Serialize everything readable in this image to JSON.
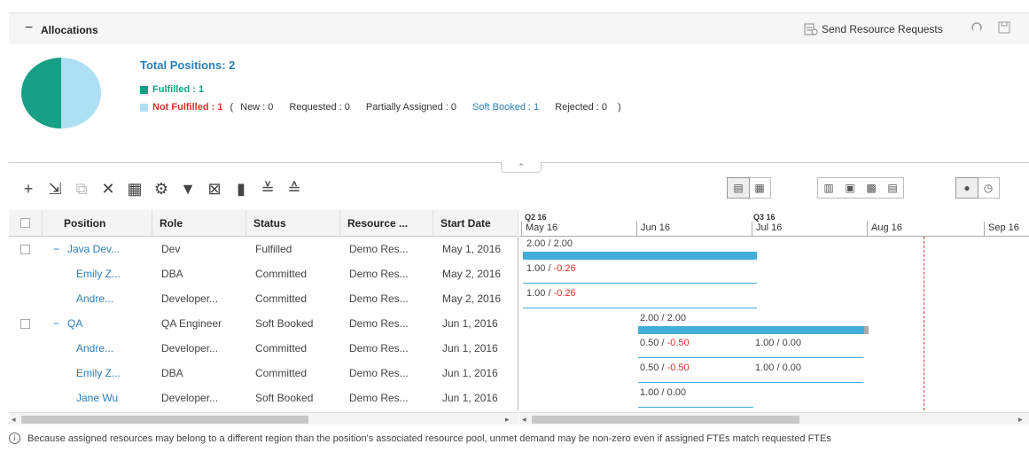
{
  "header": {
    "title": "Allocations",
    "collapse_glyph": "−",
    "send_requests": "Send Resource Requests",
    "send_icon": "send-request-icon",
    "refresh_icon": "refresh-icon",
    "save_icon": "save-icon"
  },
  "summary": {
    "total_label": "Total Positions:",
    "total_value": "2",
    "fulfilled_label": "Fulfilled : 1",
    "not_fulfilled_label": "Not Fulfilled : 1",
    "paren_open": "(",
    "paren_close": ")",
    "new": "New : 0",
    "requested": "Requested : 0",
    "partially": "Partially Assigned : 0",
    "soft_booked": "Soft Booked : 1",
    "rejected": "Rejected : 0",
    "colors": {
      "fulfilled": "#17a085",
      "not_fulfilled": "#aee0f5"
    },
    "pie": {
      "fulfilled": 1,
      "not_fulfilled": 1
    }
  },
  "grip_glyph": "⌃",
  "toolbar": {
    "icons": [
      "add-icon",
      "import-icon",
      "copy-icon",
      "delete-icon",
      "assign-icon",
      "settings-icon",
      "filter-icon",
      "export-icon",
      "chart-icon",
      "expand-all-icon",
      "collapse-all-icon"
    ],
    "glyphs": [
      "+",
      "⇲",
      "⧉",
      "✕",
      "▦",
      "⚙",
      "▼",
      "⊠",
      "▮",
      "≚",
      "≙"
    ],
    "disabled": [
      false,
      false,
      true,
      false,
      false,
      false,
      false,
      false,
      false,
      false,
      false
    ],
    "view_groups": [
      {
        "names": [
          "table-view-icon",
          "grid-view-icon"
        ],
        "glyphs": [
          "▤",
          "▦"
        ]
      },
      {
        "names": [
          "calendar-year-icon",
          "calendar-quarter-icon",
          "calendar-month-icon",
          "calendar-week-icon"
        ],
        "glyphs": [
          "▥",
          "▣",
          "▩",
          "▤"
        ]
      },
      {
        "names": [
          "person-icon",
          "clock-icon"
        ],
        "glyphs": [
          "●",
          "◷"
        ]
      }
    ]
  },
  "table": {
    "columns": [
      "Position",
      "Role",
      "Status",
      "Resource ...",
      "Start Date"
    ],
    "rows": [
      {
        "type": "group",
        "position": "Java Dev...",
        "role": "Dev",
        "status": "Fulfilled",
        "resource": "Demo Res...",
        "start": "May 1, 2016"
      },
      {
        "type": "child",
        "position": "Emily Z...",
        "role": "DBA",
        "status": "Committed",
        "resource": "Demo Res...",
        "start": "May 2, 2016"
      },
      {
        "type": "child",
        "position": "Andre...",
        "role": "Developer...",
        "status": "Committed",
        "resource": "Demo Res...",
        "start": "May 2, 2016"
      },
      {
        "type": "group",
        "position": "QA",
        "role": "QA Engineer",
        "status": "Soft Booked",
        "resource": "Demo Res...",
        "start": "Jun 1, 2016"
      },
      {
        "type": "child",
        "position": "Andre...",
        "role": "Developer...",
        "status": "Committed",
        "resource": "Demo Res...",
        "start": "Jun 1, 2016"
      },
      {
        "type": "child",
        "position": "Emily Z...",
        "role": "DBA",
        "status": "Committed",
        "resource": "Demo Res...",
        "start": "Jun 1, 2016"
      },
      {
        "type": "child",
        "position": "Jane Wu",
        "role": "Developer...",
        "status": "Soft Booked",
        "resource": "Demo Res...",
        "start": "Jun 1, 2016"
      }
    ]
  },
  "gantt": {
    "quarters": [
      "Q2 16",
      "Q3 16"
    ],
    "months": [
      "May 16",
      "Jun 16",
      "Jul 16",
      "Aug 16",
      "Sep 16"
    ],
    "rows": [
      {
        "a": "2.00 / 2.00",
        "aneg": ""
      },
      {
        "a": "1.00 / ",
        "aneg": "-0.26"
      },
      {
        "a": "1.00 / ",
        "aneg": "-0.26"
      },
      {
        "a": "2.00 / 2.00",
        "aneg": ""
      },
      {
        "a": "0.50 / ",
        "aneg": "-0.50",
        "b": "1.00 / 0.00"
      },
      {
        "a": "0.50 / ",
        "aneg": "-0.50",
        "b": "1.00 / 0.00"
      },
      {
        "a": "1.00 / 0.00",
        "aneg": ""
      }
    ]
  },
  "footer": {
    "info_icon": "info-icon",
    "info_glyph": "i",
    "note": "Because assigned resources may belong to a different region than the position's associated resource pool, unmet demand may be non-zero even if assigned FTEs match requested FTEs"
  }
}
